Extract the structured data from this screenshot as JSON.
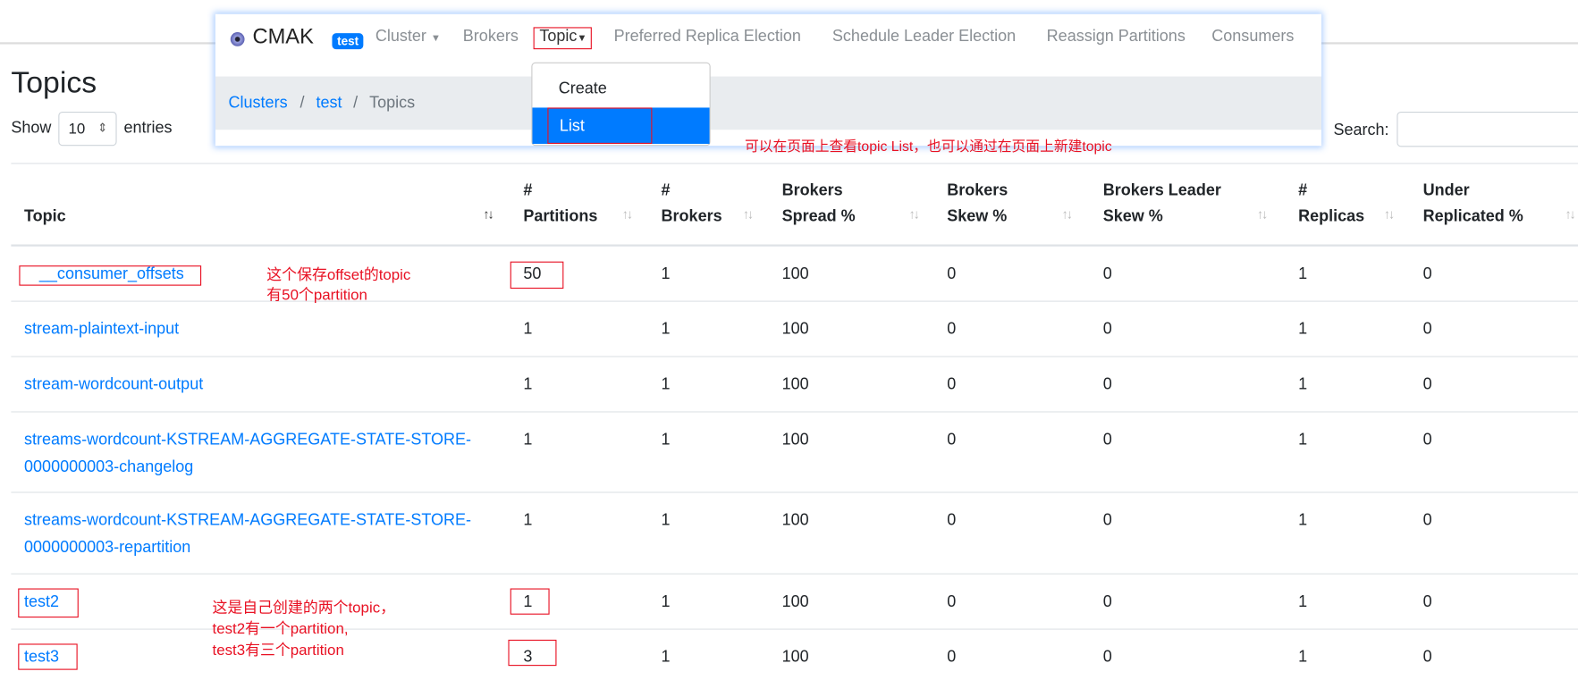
{
  "navbar": {
    "brand": "CMAK",
    "cluster_badge": "test",
    "items": [
      "Cluster",
      "Brokers",
      "Topic",
      "Preferred Replica Election",
      "Schedule Leader Election",
      "Reassign Partitions",
      "Consumers"
    ]
  },
  "breadcrumb": [
    "Clusters",
    "test",
    "Topics"
  ],
  "topic_menu": {
    "items": [
      "Create",
      "List"
    ],
    "active": "List"
  },
  "page": {
    "title": "Topics",
    "show_label": "Show",
    "entries_value": "10",
    "entries_label": "entries",
    "search_label": "Search:",
    "search_value": ""
  },
  "table": {
    "headers": [
      [
        "",
        "Topic"
      ],
      [
        "#",
        "Partitions"
      ],
      [
        "#",
        "Brokers"
      ],
      [
        "Brokers",
        "Spread %"
      ],
      [
        "Brokers",
        "Skew %"
      ],
      [
        "Brokers Leader",
        "Skew %"
      ],
      [
        "#",
        "Replicas"
      ],
      [
        "Under",
        "Replicated %"
      ]
    ],
    "rows": [
      [
        "__consumer_offsets",
        "50",
        "1",
        "100",
        "0",
        "0",
        "1",
        "0"
      ],
      [
        "stream-plaintext-input",
        "1",
        "1",
        "100",
        "0",
        "0",
        "1",
        "0"
      ],
      [
        "stream-wordcount-output",
        "1",
        "1",
        "100",
        "0",
        "0",
        "1",
        "0"
      ],
      [
        "streams-wordcount-KSTREAM-AGGREGATE-STATE-STORE-0000000003-changelog",
        "1",
        "1",
        "100",
        "0",
        "0",
        "1",
        "0"
      ],
      [
        "streams-wordcount-KSTREAM-AGGREGATE-STATE-STORE-0000000003-repartition",
        "1",
        "1",
        "100",
        "0",
        "0",
        "1",
        "0"
      ],
      [
        "test2",
        "1",
        "1",
        "100",
        "0",
        "0",
        "1",
        "0"
      ],
      [
        "test3",
        "3",
        "1",
        "100",
        "0",
        "0",
        "1",
        "0"
      ]
    ]
  },
  "annotations": {
    "menu_note": "可以在页面上查看topic List，也可以通过在页面上新建topic",
    "offsets_note_1": "这个保存offset的topic",
    "offsets_note_2": "有50个partition",
    "tests_note_1": "这是自己创建的两个topic，",
    "tests_note_2": "test2有一个partition,",
    "tests_note_3": "test3有三个partition"
  },
  "colors": {
    "link": "#007bff",
    "active_menu": "#007bff",
    "annotation": "#e81123",
    "breadcrumb_bg": "#e9ecef"
  }
}
